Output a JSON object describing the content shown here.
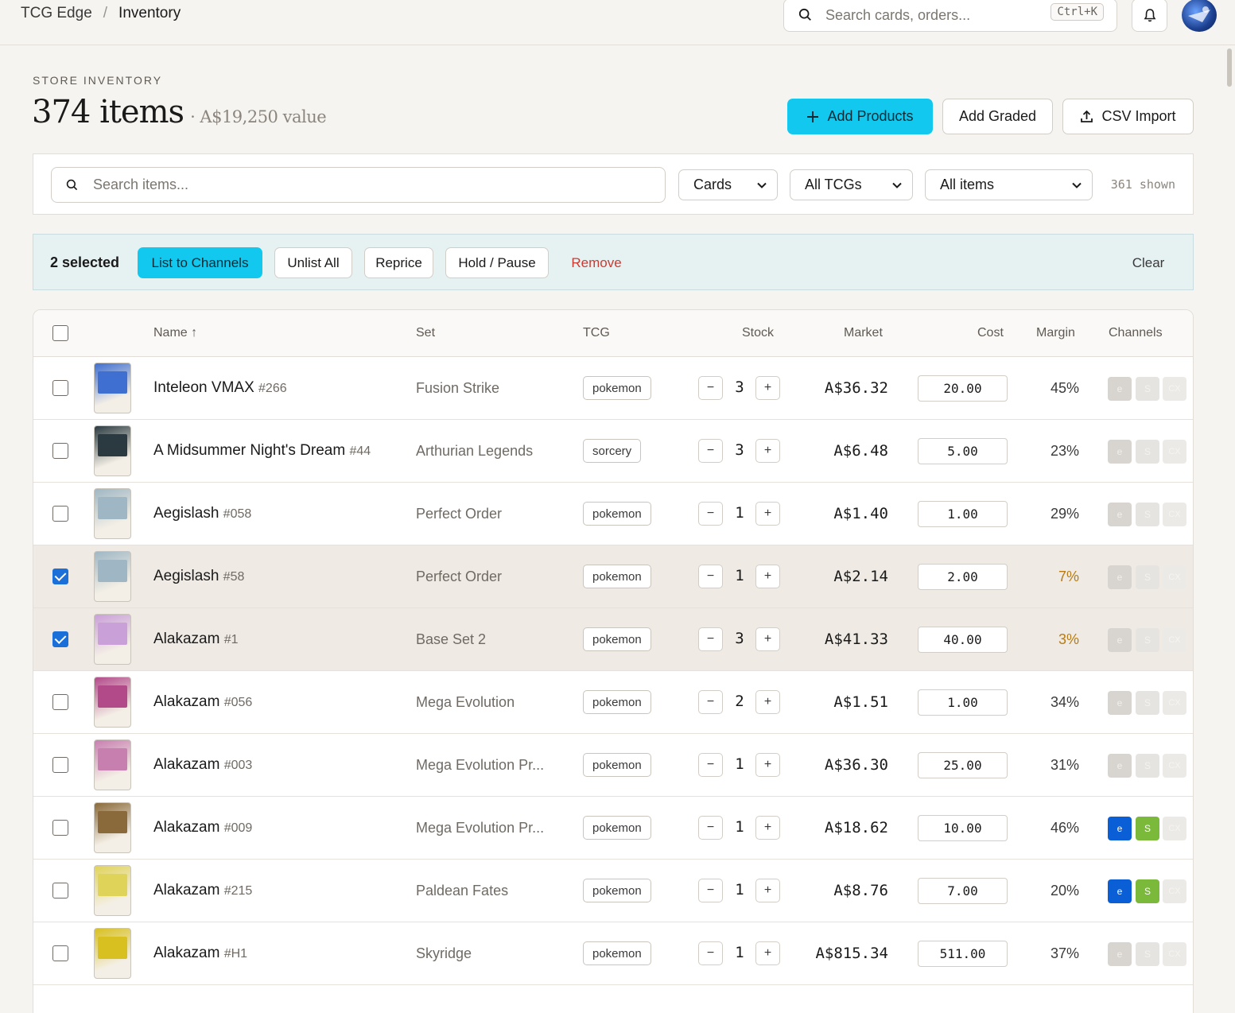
{
  "breadcrumb": {
    "root": "TCG Edge",
    "separator": "/",
    "current": "Inventory"
  },
  "global_search": {
    "placeholder": "Search cards, orders...",
    "shortcut": "Ctrl+K"
  },
  "header": {
    "eyebrow": "STORE INVENTORY",
    "count": "374 items",
    "value": "· A$19,250 value",
    "add_products": "Add Products",
    "add_graded": "Add Graded",
    "csv_import": "CSV Import"
  },
  "filters": {
    "search_placeholder": "Search items...",
    "type_select": "Cards",
    "tcg_select": "All TCGs",
    "status_select": "All items",
    "shown": "361 shown"
  },
  "selection": {
    "count": "2 selected",
    "list_to_channels": "List to Channels",
    "unlist_all": "Unlist All",
    "reprice": "Reprice",
    "hold_pause": "Hold / Pause",
    "remove": "Remove",
    "clear": "Clear"
  },
  "table": {
    "headers": {
      "name": "Name ↑",
      "set": "Set",
      "tcg": "TCG",
      "stock": "Stock",
      "market": "Market",
      "cost": "Cost",
      "margin": "Margin",
      "channels": "Channels"
    },
    "channel_labels": {
      "ebay": "e",
      "shopify": "S",
      "cx": "CX"
    },
    "rows": [
      {
        "name": "Inteleon VMAX",
        "number": "#266",
        "set": "Fusion Strike",
        "tcg": "pokemon",
        "stock": "3",
        "market": "A$36.32",
        "cost": "20.00",
        "margin": "45%",
        "selected": false,
        "margin_warn": false,
        "ebay": false,
        "shopify": false,
        "art": "#3f6fd0"
      },
      {
        "name": "A Midsummer Night's Dream",
        "number": "#44",
        "set": "Arthurian Legends",
        "tcg": "sorcery",
        "stock": "3",
        "market": "A$6.48",
        "cost": "5.00",
        "margin": "23%",
        "selected": false,
        "margin_warn": false,
        "ebay": false,
        "shopify": false,
        "art": "#2a3a40"
      },
      {
        "name": "Aegislash",
        "number": "#058",
        "set": "Perfect Order",
        "tcg": "pokemon",
        "stock": "1",
        "market": "A$1.40",
        "cost": "1.00",
        "margin": "29%",
        "selected": false,
        "margin_warn": false,
        "ebay": false,
        "shopify": false,
        "art": "#9fb7c4"
      },
      {
        "name": "Aegislash",
        "number": "#58",
        "set": "Perfect Order",
        "tcg": "pokemon",
        "stock": "1",
        "market": "A$2.14",
        "cost": "2.00",
        "margin": "7%",
        "selected": true,
        "margin_warn": true,
        "ebay": false,
        "shopify": false,
        "art": "#9fb7c4"
      },
      {
        "name": "Alakazam",
        "number": "#1",
        "set": "Base Set 2",
        "tcg": "pokemon",
        "stock": "3",
        "market": "A$41.33",
        "cost": "40.00",
        "margin": "3%",
        "selected": true,
        "margin_warn": true,
        "ebay": false,
        "shopify": false,
        "art": "#c9a0d8"
      },
      {
        "name": "Alakazam",
        "number": "#056",
        "set": "Mega Evolution",
        "tcg": "pokemon",
        "stock": "2",
        "market": "A$1.51",
        "cost": "1.00",
        "margin": "34%",
        "selected": false,
        "margin_warn": false,
        "ebay": false,
        "shopify": false,
        "art": "#b24a8a"
      },
      {
        "name": "Alakazam",
        "number": "#003",
        "set": "Mega Evolution Pr...",
        "tcg": "pokemon",
        "stock": "1",
        "market": "A$36.30",
        "cost": "25.00",
        "margin": "31%",
        "selected": false,
        "margin_warn": false,
        "ebay": false,
        "shopify": false,
        "art": "#c77fb0"
      },
      {
        "name": "Alakazam",
        "number": "#009",
        "set": "Mega Evolution Pr...",
        "tcg": "pokemon",
        "stock": "1",
        "market": "A$18.62",
        "cost": "10.00",
        "margin": "46%",
        "selected": false,
        "margin_warn": false,
        "ebay": true,
        "shopify": true,
        "art": "#8a6a3a"
      },
      {
        "name": "Alakazam",
        "number": "#215",
        "set": "Paldean Fates",
        "tcg": "pokemon",
        "stock": "1",
        "market": "A$8.76",
        "cost": "7.00",
        "margin": "20%",
        "selected": false,
        "margin_warn": false,
        "ebay": true,
        "shopify": true,
        "art": "#e0d35a"
      },
      {
        "name": "Alakazam",
        "number": "#H1",
        "set": "Skyridge",
        "tcg": "pokemon",
        "stock": "1",
        "market": "A$815.34",
        "cost": "511.00",
        "margin": "37%",
        "selected": false,
        "margin_warn": false,
        "ebay": false,
        "shopify": false,
        "art": "#d8c020"
      }
    ]
  },
  "colors": {
    "accent": "#12c8ee",
    "danger": "#cc3b32",
    "warn": "#b87b12",
    "ebay": "#0a5fd6",
    "shopify": "#7ab93a"
  }
}
